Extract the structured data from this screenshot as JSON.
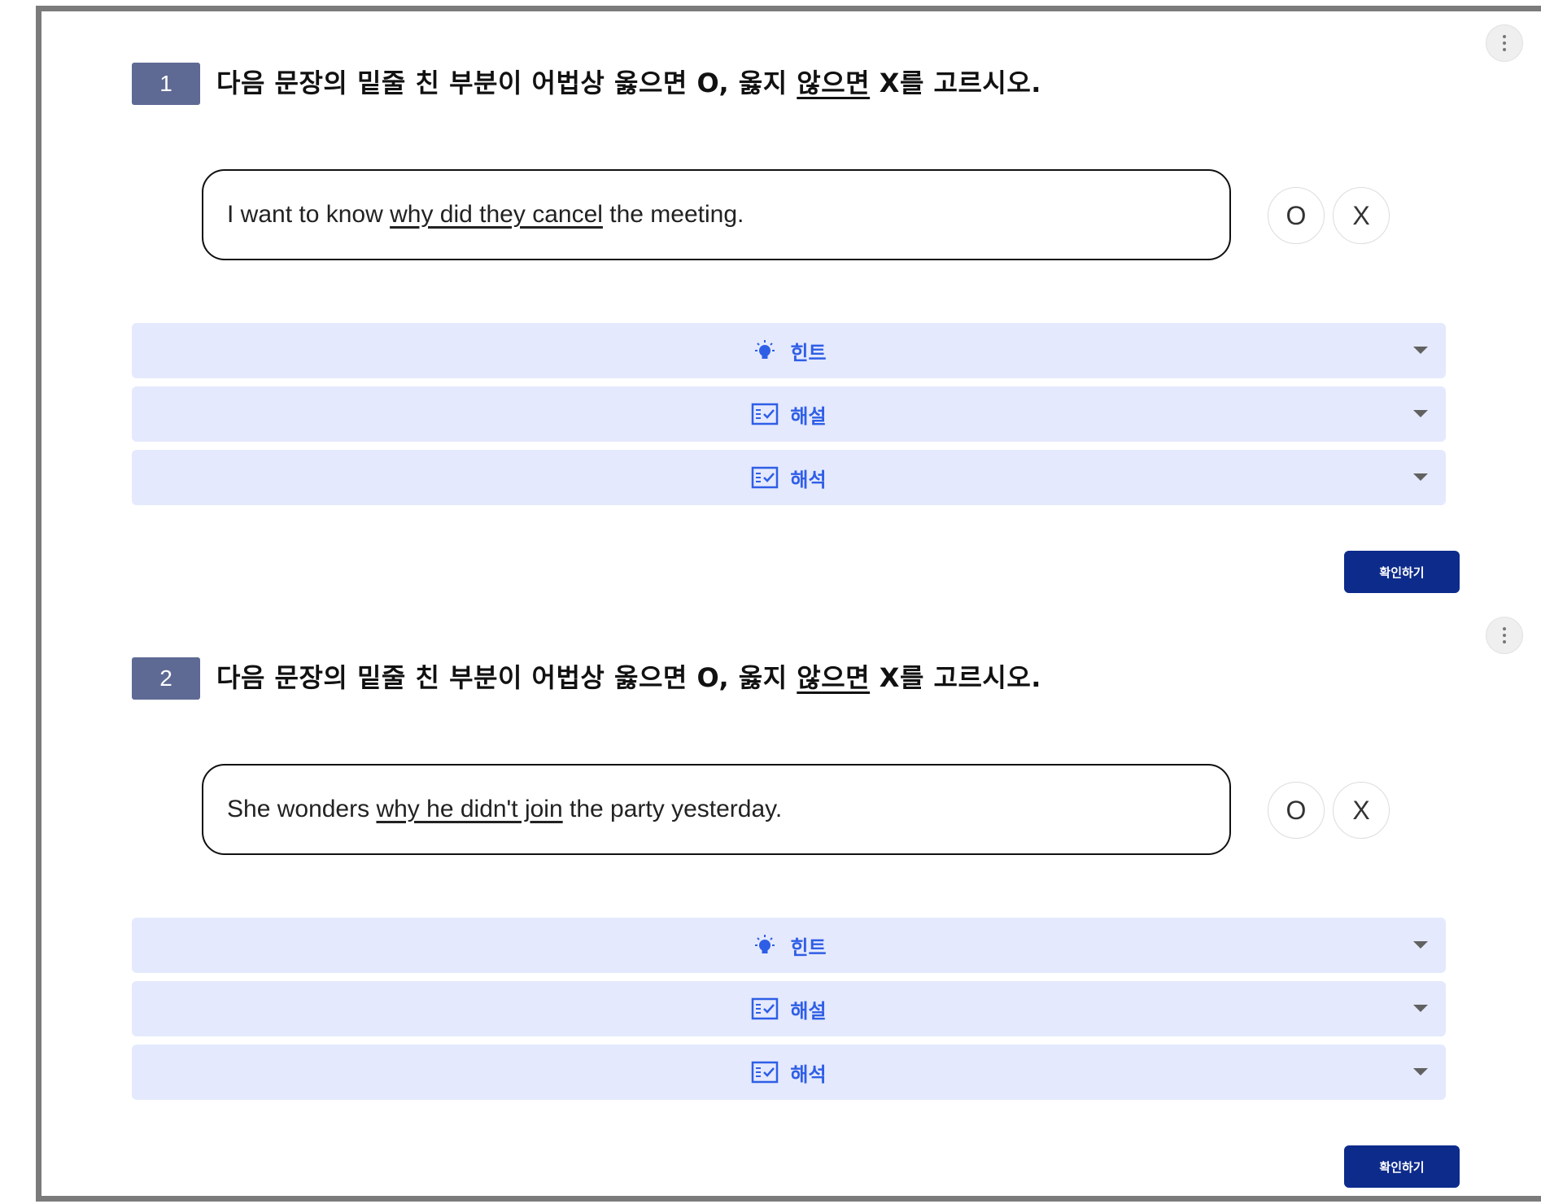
{
  "questions": [
    {
      "number": "1",
      "prompt": {
        "before": "다음 문장의 밑줄 친 부분이 어법상 옳으면 O, 옳지 ",
        "underlined": "않으면",
        "after": " X를 고르시오."
      },
      "sentence": {
        "before": "I want to know ",
        "underlined": "why did they cancel",
        "after": " the meeting."
      },
      "options": [
        "O",
        "X"
      ],
      "sections": [
        {
          "label": "힌트",
          "icon": "lightbulb-icon"
        },
        {
          "label": "해설",
          "icon": "checklist-icon"
        },
        {
          "label": "해석",
          "icon": "checklist-icon"
        }
      ],
      "confirm_label": "확인하기"
    },
    {
      "number": "2",
      "prompt": {
        "before": "다음 문장의 밑줄 친 부분이 어법상 옳으면 O, 옳지 ",
        "underlined": "않으면",
        "after": " X를 고르시오."
      },
      "sentence": {
        "before": "She wonders ",
        "underlined": "why he didn't join",
        "after": " the party yesterday."
      },
      "options": [
        "O",
        "X"
      ],
      "sections": [
        {
          "label": "힌트",
          "icon": "lightbulb-icon"
        },
        {
          "label": "해설",
          "icon": "checklist-icon"
        },
        {
          "label": "해석",
          "icon": "checklist-icon"
        }
      ],
      "confirm_label": "확인하기"
    }
  ],
  "colors": {
    "number_badge": "#5e6a94",
    "accordion_bg": "#e4e9fd",
    "accordion_text": "#2f5ee6",
    "confirm_button": "#0d2b8b"
  }
}
